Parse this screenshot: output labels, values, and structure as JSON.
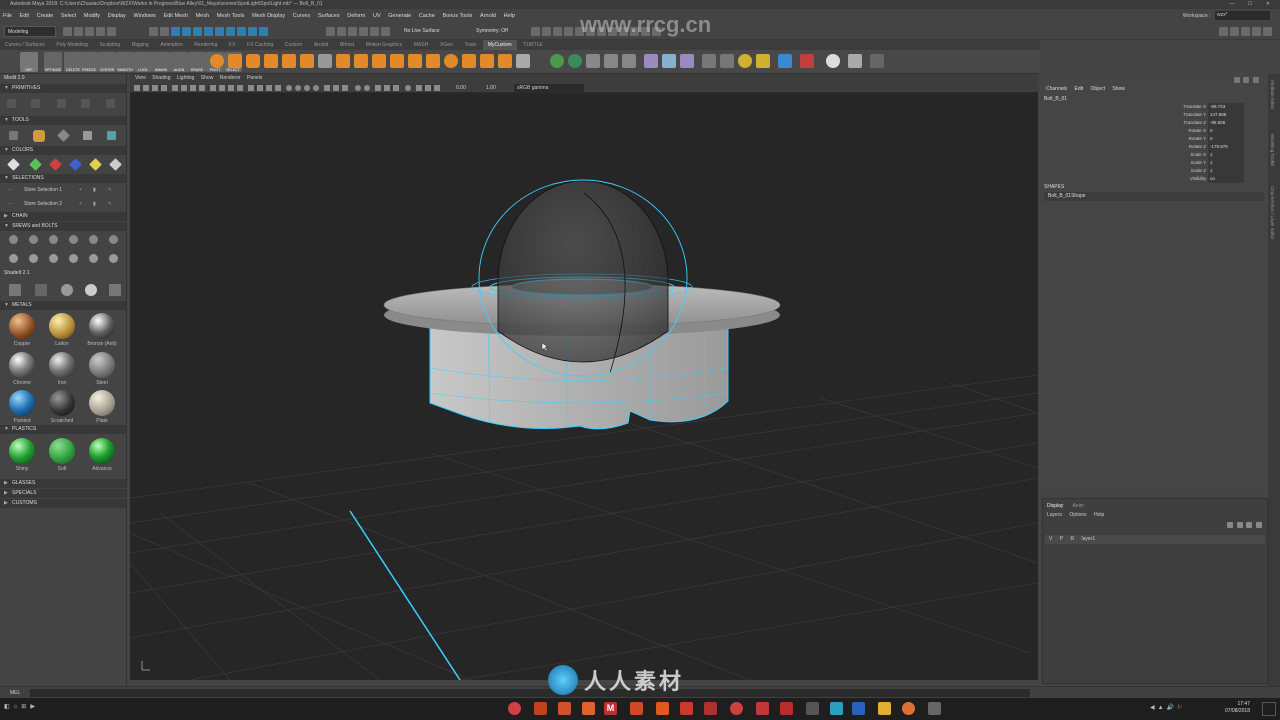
{
  "titlebar": {
    "text": "Autodesk Maya 2018: C:\\Users\\Chaulac\\Dropbox\\WZX\\Works in Progress\\Blue Alley\\01_Maya\\scenes\\SpotLight\\SpotLight.mb*   ---   Bolt_B_01",
    "window_buttons": "— ☐ ✕"
  },
  "menubar": {
    "items": [
      "File",
      "Edit",
      "Create",
      "Select",
      "Modify",
      "Display",
      "Windows",
      "Edit Mesh",
      "Mesh",
      "Mesh Tools",
      "Mesh Display",
      "Curves",
      "Surfaces",
      "Deform",
      "UV",
      "Generate",
      "Cache",
      "Bonus Tools",
      "Arnold",
      "Help"
    ],
    "workspace_label": "Workspace :",
    "workspace_value": "wzx*"
  },
  "statusline": {
    "mode": "Modeling",
    "live_surface": "No Live Surface",
    "symmetry": "Symmetry: Off"
  },
  "shelf_tabs": [
    "Curves / Surfaces",
    "Poly Modeling",
    "Sculpting",
    "Rigging",
    "Animation",
    "Rendering",
    "FX",
    "FX Caching",
    "Custom",
    "Arnold",
    "Bifrost",
    "Motion Graphics",
    "MASH",
    "XGen",
    "Tools",
    "MyCustom",
    "TURTLE"
  ],
  "shelf_active_tab": "MyCustom",
  "shelf_labels": [
    "DEF",
    "OPTIMIZE",
    "DELETE",
    "FREEZE",
    "CENTER",
    "SMOOTH",
    "LOCK",
    "SMASH",
    "ALIGN",
    "ERASE",
    "PIVOT",
    "SELECT"
  ],
  "leftpanel": {
    "title": "Modit 2.0",
    "sections": {
      "primitives": "PRIMITIVES",
      "tools": "TOOLS",
      "colors": "COLORS",
      "selections": "SELECTIONS",
      "chain": "CHAIN",
      "screws": "SREWS and BOLTS",
      "shadeit": "ShadeIt 2.1",
      "metals": "METALS",
      "plastics": "PLASTICS",
      "glasses": "GLASSES",
      "specials": "SPECIALS",
      "customs": "CUSTOMS"
    },
    "store_selection_1": "Store Selection 1",
    "store_selection_2": "Store Selection 2",
    "metals": [
      "Copper",
      "Laiton",
      "Bronze (Anti)",
      "Chrome",
      "Iron",
      "Steel",
      "Painted",
      "Scratched",
      "Plate"
    ],
    "plastics": [
      "Shiny",
      "Soft",
      "Advance"
    ]
  },
  "viewport": {
    "menu": [
      "View",
      "Shading",
      "Lighting",
      "Show",
      "Renderer",
      "Panels"
    ],
    "field_a": "0.00",
    "field_b": "1.00",
    "colorspace": "sRGB gamma"
  },
  "channelbox": {
    "menu": [
      "Channels",
      "Edit",
      "Object",
      "Show"
    ],
    "object": "Bolt_B_01",
    "channels": [
      {
        "label": "Translate X",
        "value": "-69.723"
      },
      {
        "label": "Translate Y",
        "value": "147.589"
      },
      {
        "label": "Translate Z",
        "value": "-95.506"
      },
      {
        "label": "Rotate X",
        "value": "0"
      },
      {
        "label": "Rotate Y",
        "value": "0"
      },
      {
        "label": "Rotate Z",
        "value": "-179.978"
      },
      {
        "label": "Scale X",
        "value": "1"
      },
      {
        "label": "Scale Y",
        "value": "1"
      },
      {
        "label": "Scale Z",
        "value": "1"
      },
      {
        "label": "Visibility",
        "value": "on"
      }
    ],
    "shapes_header": "SHAPES",
    "shape_name": "Bolt_B_01Shape"
  },
  "layers": {
    "tabs": [
      "Display",
      "Anim"
    ],
    "menu": [
      "Layers",
      "Options",
      "Help"
    ],
    "row_flags": [
      "V",
      "P",
      "R"
    ],
    "layer_name": "layer1"
  },
  "side_tabs": [
    "Attribute Editor",
    "Modeling Toolkit",
    "Channel Box / Layer Editor"
  ],
  "cmdline": {
    "label": "MEL"
  },
  "taskbar": {
    "time": "17:47",
    "date": "07/08/2018"
  },
  "watermark": {
    "brand": "人人素材",
    "url": "www.rrcg.cn"
  },
  "colors": {
    "selection": "#3ad0ff",
    "viewport": "#262626",
    "panel": "#444444"
  }
}
